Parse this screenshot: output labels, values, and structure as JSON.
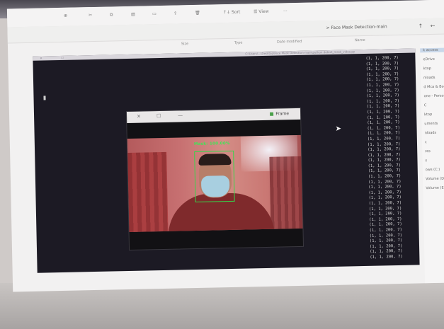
{
  "explorer": {
    "toolbar": {
      "sort": "↑↓ Sort",
      "view": "☰ View",
      "more": "···"
    },
    "address": {
      "path": "> Face Mask Detection-main"
    },
    "columns": [
      "Name",
      "Date modified",
      "Type",
      "Size"
    ],
    "sidebar_items": [
      {
        "label": "k access",
        "selected": true
      },
      {
        "label": "eDrive"
      },
      {
        "label": "ktop"
      },
      {
        "label": "nloads"
      },
      {
        "label": "d Mca & Bsc Itt"
      },
      {
        "label": "one - Personal"
      },
      {
        "label": "C"
      },
      {
        "label": "ktop"
      },
      {
        "label": "uments"
      },
      {
        "label": "nloads"
      },
      {
        "label": "c"
      },
      {
        "label": "res"
      },
      {
        "label": "s"
      },
      {
        "label": "ows (C:)"
      },
      {
        "label": "Volume (D:)"
      },
      {
        "label": "Volume (E:)"
      }
    ]
  },
  "console": {
    "title": "C:\\Users\\...\\Desktop\\Face Mask Detection-main\\python detect_mask_video.py",
    "output_lines": [
      "(1, 1, 200, 7)",
      "(1, 1, 200, 7)",
      "(1, 1, 200, 7)",
      "(1, 1, 200, 7)",
      "(1, 1, 200, 7)",
      "(1, 1, 200, 7)",
      "(1, 1, 200, 7)",
      "(1, 1, 200, 7)",
      "(1, 1, 200, 7)",
      "(1, 1, 200, 7)",
      "(1, 1, 200, 7)",
      "(1, 1, 200, 7)",
      "(1, 1, 200, 7)",
      "(1, 1, 200, 7)",
      "(1, 1, 200, 7)",
      "(1, 1, 200, 7)",
      "(1, 1, 200, 7)",
      "(1, 1, 200, 7)",
      "(1, 1, 200, 7)",
      "(1, 1, 200, 7)",
      "(1, 1, 200, 7)",
      "(1, 1, 200, 7)",
      "(1, 1, 200, 7)",
      "(1, 1, 200, 7)",
      "(1, 1, 200, 7)",
      "(1, 1, 200, 7)",
      "(1, 1, 200, 7)",
      "(1, 1, 200, 7)",
      "(1, 1, 200, 7)",
      "(1, 1, 200, 7)",
      "(1, 1, 200, 7)",
      "(1, 1, 200, 7)",
      "(1, 1, 200, 7)",
      "(1, 1, 200, 7)",
      "(1, 1, 200, 7)",
      "(1, 1, 200, 7)",
      "(1, 1, 200, 7)",
      "(1, 1, 200, 7)"
    ]
  },
  "frame_window": {
    "title": "Frame",
    "close": "✕",
    "maximize": "☐",
    "minimize": "—",
    "detection_label": "Mask: 100.00%",
    "box_color": "#34d84a"
  }
}
